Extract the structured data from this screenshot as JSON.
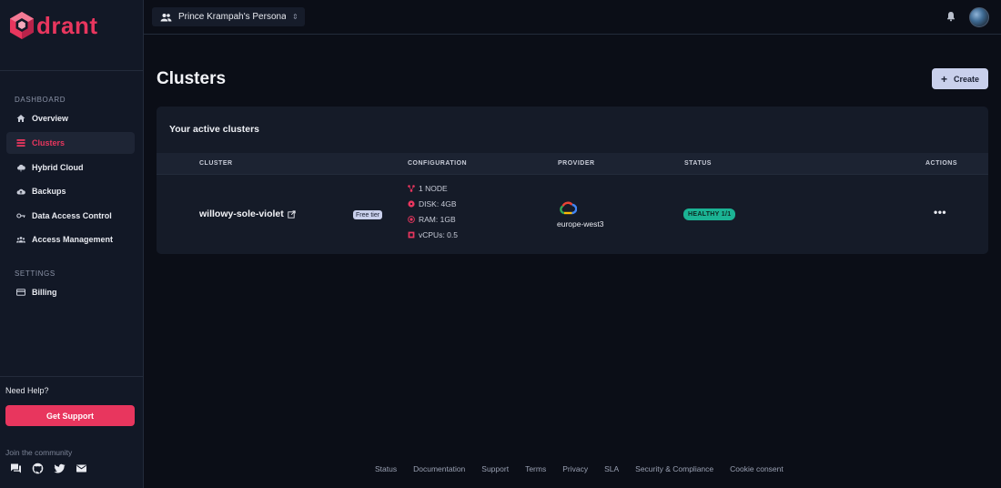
{
  "brand": {
    "name": "drant",
    "accent": "#e8365e"
  },
  "sidebar": {
    "dashboard_section": "DASHBOARD",
    "items": [
      {
        "label": "Overview",
        "icon": "home-icon"
      },
      {
        "label": "Clusters",
        "icon": "list-icon",
        "active": true
      },
      {
        "label": "Hybrid Cloud",
        "icon": "cloud-icon"
      },
      {
        "label": "Backups",
        "icon": "cloud-upload-icon"
      },
      {
        "label": "Data Access Control",
        "icon": "key-icon"
      },
      {
        "label": "Access Management",
        "icon": "people-icon"
      }
    ],
    "settings_section": "SETTINGS",
    "settings_items": [
      {
        "label": "Billing",
        "icon": "credit-card-icon"
      }
    ],
    "need_help": "Need Help?",
    "support_button": "Get Support",
    "community_label": "Join the community",
    "social": [
      "forum-icon",
      "github-icon",
      "twitter-icon",
      "mail-icon"
    ]
  },
  "topbar": {
    "org_name": "Prince Krampah's Personal ...",
    "org_icon": "people-icon",
    "notifications_icon": "bell-icon"
  },
  "main": {
    "title": "Clusters",
    "create_button": "Create",
    "panel_title": "Your active clusters",
    "columns": [
      "CLUSTER",
      "CONFIGURATION",
      "PROVIDER",
      "STATUS",
      "ACTIONS"
    ],
    "clusters": [
      {
        "name": "willowy-sole-violet",
        "tier": "Free tier",
        "config": {
          "nodes": "1 NODE",
          "disk": "DISK: 4GB",
          "ram": "RAM: 1GB",
          "vcpus": "vCPUs: 0.5"
        },
        "provider_icon": "google-cloud-icon",
        "region": "europe-west3",
        "status": "HEALTHY 1/1",
        "status_color": "#1bb394",
        "actions": "•••"
      }
    ]
  },
  "footer": {
    "links": [
      "Status",
      "Documentation",
      "Support",
      "Terms",
      "Privacy",
      "SLA",
      "Security & Compliance",
      "Cookie consent"
    ]
  }
}
